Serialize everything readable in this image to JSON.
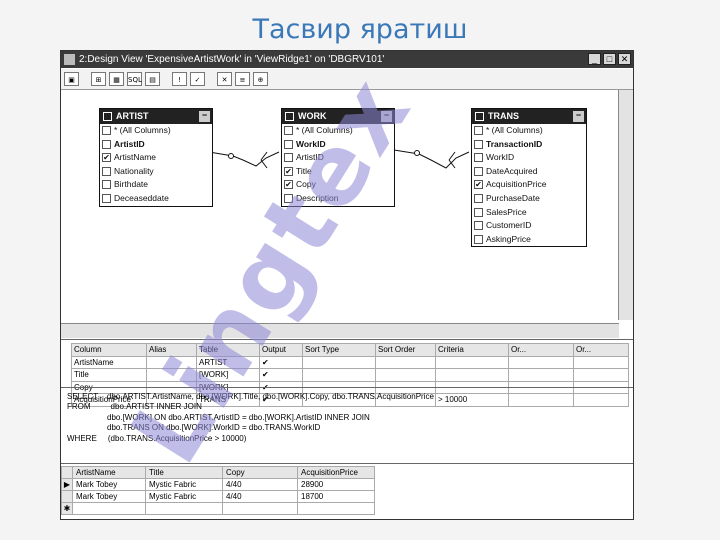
{
  "slide": {
    "title": "Тасвир яратиш"
  },
  "window": {
    "title": "2:Design View 'ExpensiveArtistWork' in 'ViewRidge1' on 'DBGRV101'",
    "buttons": {
      "minimize": "_",
      "maximize": "□",
      "close": "✕"
    }
  },
  "toolbar": {
    "items": [
      {
        "icon": "save-icon",
        "glyph": "▣"
      },
      {
        "icon": "diagram-pane-icon",
        "glyph": "⊞"
      },
      {
        "icon": "grid-pane-icon",
        "glyph": "▦"
      },
      {
        "icon": "sql-pane-icon",
        "glyph": "SQL"
      },
      {
        "icon": "results-pane-icon",
        "glyph": "▤"
      },
      {
        "icon": "run-icon",
        "glyph": "!"
      },
      {
        "icon": "verify-icon",
        "glyph": "✓"
      },
      {
        "icon": "remove-filter-icon",
        "glyph": "✕"
      },
      {
        "icon": "group-by-icon",
        "glyph": "≡"
      },
      {
        "icon": "add-table-icon",
        "glyph": "⊕"
      }
    ]
  },
  "tables": {
    "artist": {
      "name": "ARTIST",
      "columns": [
        {
          "label": "* (All Columns)",
          "checked": false,
          "key": false
        },
        {
          "label": "ArtistID",
          "checked": false,
          "key": true
        },
        {
          "label": "ArtistName",
          "checked": true,
          "key": false
        },
        {
          "label": "Nationality",
          "checked": false,
          "key": false
        },
        {
          "label": "Birthdate",
          "checked": false,
          "key": false
        },
        {
          "label": "Deceaseddate",
          "checked": false,
          "key": false
        }
      ]
    },
    "work": {
      "name": "WORK",
      "columns": [
        {
          "label": "* (All Columns)",
          "checked": false,
          "key": false
        },
        {
          "label": "WorkID",
          "checked": false,
          "key": true
        },
        {
          "label": "ArtistID",
          "checked": false,
          "key": false
        },
        {
          "label": "Title",
          "checked": true,
          "key": false
        },
        {
          "label": "Copy",
          "checked": true,
          "key": false
        },
        {
          "label": "Description",
          "checked": false,
          "key": false
        }
      ]
    },
    "trans": {
      "name": "TRANS",
      "columns": [
        {
          "label": "* (All Columns)",
          "checked": false,
          "key": false
        },
        {
          "label": "TransactionID",
          "checked": false,
          "key": true
        },
        {
          "label": "WorkID",
          "checked": false,
          "key": false
        },
        {
          "label": "DateAcquired",
          "checked": false,
          "key": false
        },
        {
          "label": "AcquisitionPrice",
          "checked": true,
          "key": false
        },
        {
          "label": "PurchaseDate",
          "checked": false,
          "key": false
        },
        {
          "label": "SalesPrice",
          "checked": false,
          "key": false
        },
        {
          "label": "CustomerID",
          "checked": false,
          "key": false
        },
        {
          "label": "AskingPrice",
          "checked": false,
          "key": false
        }
      ]
    }
  },
  "grid": {
    "headers": [
      "Column",
      "Alias",
      "Table",
      "Output",
      "Sort Type",
      "Sort Order",
      "Criteria",
      "Or...",
      "Or..."
    ],
    "rows": [
      [
        "ArtistName",
        "",
        "ARTIST",
        "✔",
        "",
        "",
        "",
        "",
        ""
      ],
      [
        "Title",
        "",
        "[WORK]",
        "✔",
        "",
        "",
        "",
        "",
        ""
      ],
      [
        "Copy",
        "",
        "[WORK]",
        "✔",
        "",
        "",
        "",
        "",
        ""
      ],
      [
        "AcquisitionPrice",
        "",
        "TRANS",
        "✔",
        "",
        "",
        "> 10000",
        "",
        ""
      ]
    ]
  },
  "sql": {
    "lines": [
      "SELECT    dbo.ARTIST.ArtistName, dbo.[WORK].Title, dbo.[WORK].Copy, dbo.TRANS.AcquisitionPrice",
      "FROM         dbo.ARTIST INNER JOIN",
      "                  dbo.[WORK] ON dbo.ARTIST.ArtistID = dbo.[WORK].ArtistID INNER JOIN",
      "                  dbo.TRANS ON dbo.[WORK].WorkID = dbo.TRANS.WorkID",
      "WHERE     (dbo.TRANS.AcquisitionPrice > 10000)"
    ]
  },
  "results": {
    "headers": [
      "ArtistName",
      "Title",
      "Copy",
      "AcquisitionPrice"
    ],
    "rows": [
      [
        "Mark Tobey",
        "Mystic Fabric",
        "4/40",
        "28900"
      ],
      [
        "Mark Tobey",
        "Mystic Fabric",
        "4/40",
        "18700"
      ]
    ],
    "markers": [
      "▶",
      "",
      "✱"
    ]
  },
  "watermark": {
    "text": "Lingtex"
  },
  "colors": {
    "title": "#3a78b8",
    "watermark": "#8c86d6"
  }
}
